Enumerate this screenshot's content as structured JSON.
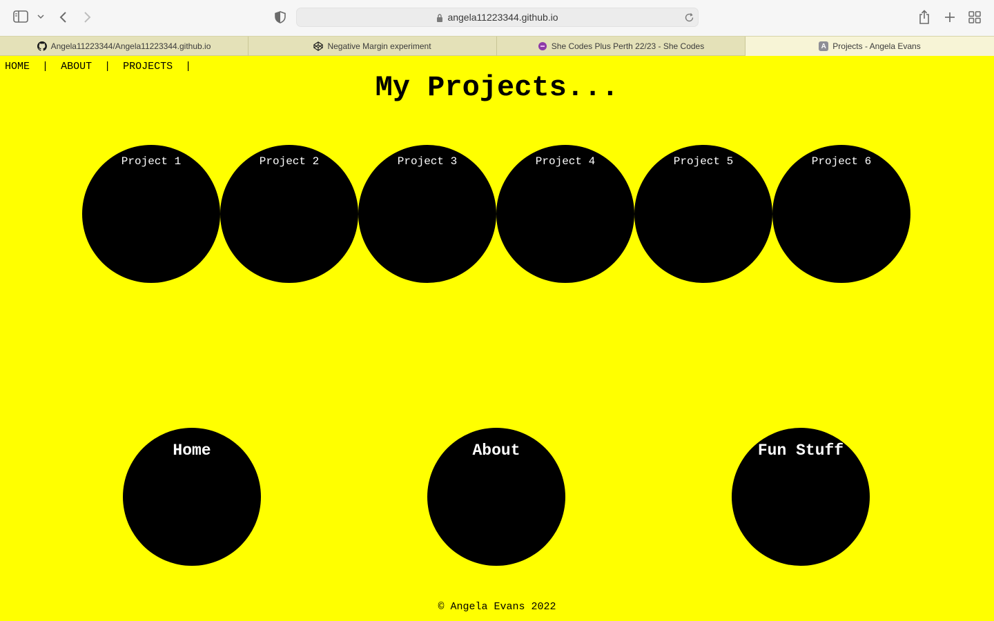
{
  "browser": {
    "url": "angela11223344.github.io",
    "icons": [
      "sidebar-icon",
      "chevron-down-icon",
      "back-icon",
      "forward-icon",
      "shield-icon",
      "lock-icon",
      "reload-icon",
      "share-icon",
      "new-tab-icon",
      "tab-overview-icon"
    ],
    "tabs": [
      {
        "label": "Angela11223344/Angela11223344.github.io",
        "icon": "github-icon"
      },
      {
        "label": "Negative Margin experiment",
        "icon": "codepen-icon"
      },
      {
        "label": "She Codes Plus Perth 22/23 - She Codes",
        "icon": "shecodes-icon"
      },
      {
        "label": "Projects - Angela Evans",
        "icon": "a-letter-icon",
        "favicon_letter": "A",
        "active": true
      }
    ]
  },
  "page": {
    "background": "#ffff00",
    "nav": {
      "items": [
        "HOME",
        "ABOUT",
        "PROJECTS"
      ],
      "separator": "|"
    },
    "title": "My Projects...",
    "projects": [
      "Project 1",
      "Project 2",
      "Project 3",
      "Project 4",
      "Project 5",
      "Project 6"
    ],
    "links": [
      "Home",
      "About",
      "Fun Stuff"
    ],
    "footer": "© Angela Evans 2022"
  }
}
